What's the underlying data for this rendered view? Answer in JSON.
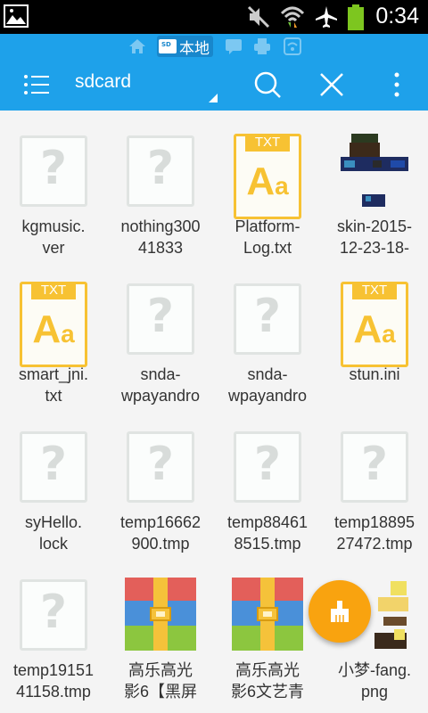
{
  "statusbar": {
    "time": "0:34",
    "icons": [
      "gallery-icon",
      "mute-icon",
      "wifi-icon",
      "airplane-icon",
      "battery-icon"
    ]
  },
  "breadcrumbs": {
    "items": [
      "home-icon",
      "local-storage",
      "chat-icon",
      "printer-icon",
      "network-icon"
    ],
    "local_label": "本地"
  },
  "toolbar": {
    "path": "sdcard",
    "icons": [
      "menu-icon",
      "search-icon",
      "close-icon",
      "overflow-icon"
    ]
  },
  "files": [
    {
      "name": "kgmusic.\nver",
      "type": "unknown"
    },
    {
      "name": "nothing300\n41833",
      "type": "unknown"
    },
    {
      "name": "Platform-\nLog.txt",
      "type": "txt"
    },
    {
      "name": "skin-2015-\n12-23-18-",
      "type": "image"
    },
    {
      "name": "smart_jni.\ntxt",
      "type": "txt"
    },
    {
      "name": "snda-\nwpayandro",
      "type": "unknown"
    },
    {
      "name": "snda-\nwpayandro",
      "type": "unknown"
    },
    {
      "name": "stun.ini",
      "type": "txt"
    },
    {
      "name": "syHello.\nlock",
      "type": "unknown"
    },
    {
      "name": "temp16662\n900.tmp",
      "type": "unknown"
    },
    {
      "name": "temp88461\n8515.tmp",
      "type": "unknown"
    },
    {
      "name": "temp18895\n27472.tmp",
      "type": "unknown"
    },
    {
      "name": "temp19151\n41158.tmp",
      "type": "unknown"
    },
    {
      "name": "高乐高光\n影6【黑屏",
      "type": "archive"
    },
    {
      "name": "高乐高光\n影6文艺青",
      "type": "archive"
    },
    {
      "name": "小梦-fang.\npng",
      "type": "image"
    }
  ],
  "txt_tag": "TXT",
  "txt_glyph_big": "A",
  "txt_glyph_small": "a",
  "unknown_glyph": "?",
  "fab": {
    "icon": "clean-brush-icon"
  },
  "colors": {
    "accent": "#1ea1ea",
    "fab": "#f9a30f",
    "txt": "#f7c233"
  }
}
